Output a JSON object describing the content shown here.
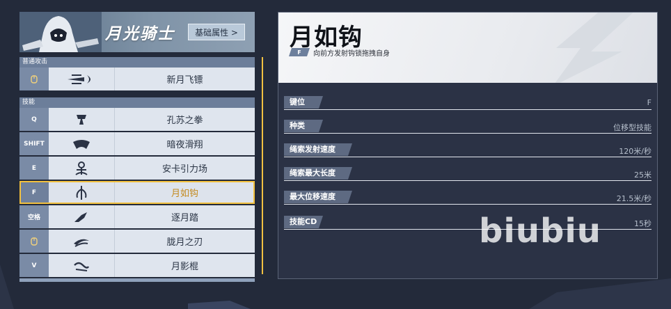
{
  "hero": {
    "name": "月光骑士",
    "attr_button": "基础属性 >"
  },
  "sections": {
    "basic_attack": "普通攻击",
    "skills": "技能"
  },
  "basic_attack": {
    "key": "🕲",
    "name": "新月飞镖"
  },
  "skills": [
    {
      "key": "Q",
      "name": "孔苏之拳"
    },
    {
      "key": "SHIFT",
      "name": "暗夜滑翔"
    },
    {
      "key": "E",
      "name": "安卡引力场"
    },
    {
      "key": "F",
      "name": "月如钩"
    },
    {
      "key": "空格",
      "name": "逐月踏"
    },
    {
      "key": "mouse",
      "name": "胧月之刃"
    },
    {
      "key": "V",
      "name": "月影棍"
    }
  ],
  "selected_skill": 3,
  "detail": {
    "title": "月如钩",
    "key": "F",
    "description": "向前方发射钩锁拖拽自身",
    "stats": [
      {
        "label": "键位",
        "value": "F"
      },
      {
        "label": "种类",
        "value": "位移型技能"
      },
      {
        "label": "绳索发射速度",
        "value": "120米/秒"
      },
      {
        "label": "绳索最大长度",
        "value": "25米"
      },
      {
        "label": "最大位移速度",
        "value": "21.5米/秒"
      },
      {
        "label": "技能CD",
        "value": "15秒"
      }
    ]
  },
  "watermark": "biubiu",
  "colors": {
    "accent": "#f2c142",
    "page_bg": "#232a3a",
    "row_bg": "#dfe5ee",
    "key_bg": "#7a8ba6",
    "active_text": "#c48a1e"
  }
}
